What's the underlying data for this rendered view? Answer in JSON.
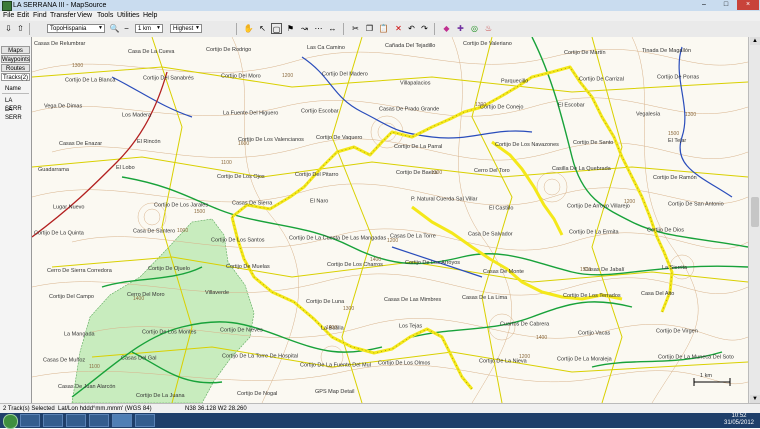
{
  "window": {
    "title": "LA SERRANA III - MapSource",
    "minimize": "–",
    "maximize": "□",
    "close": "×"
  },
  "menu": [
    "File",
    "Edit",
    "Find",
    "Transfer",
    "View",
    "Tools",
    "Utilities",
    "Help"
  ],
  "toolbar": {
    "map_product": "TopoHispania",
    "zoom_level": "1 km",
    "detail": "Highest"
  },
  "sidebar": {
    "tabs": [
      "Maps",
      "Waypoints",
      "Routes",
      "Tracks(2)"
    ],
    "column_header": "Name",
    "items": [
      "LA SERR",
      "LA SERR"
    ]
  },
  "map": {
    "labels": [
      "Casas De Relumbrar",
      "Casa De La Cueva",
      "Cortijo De Rodrigo",
      "Las Ca Camino",
      "Cañada Del Tejadillo",
      "Cortijo De Valeriano",
      "Cortijo De Martín",
      "Tinada De Magallón",
      "Cortijo De La Blanca",
      "Cortijo Del Sanabrés",
      "Cortijo Del Moro",
      "Cortijo Del Madero",
      "Villapalacios",
      "Parquecillo",
      "Cortijo De Carrizal",
      "Cortijo De Porras",
      "Vega De Dimas",
      "Los Madera",
      "La Fuente Del Higuero",
      "Cortijo Escobar",
      "Casas De Prado Grande",
      "Cortijo De Conejo",
      "El Escobar",
      "Vegalesía",
      "Casas De Enazar",
      "El Rincón",
      "Cortijo De Los Valencianos",
      "Cortijo De Vaquero",
      "Cortijo De La Parral",
      "Cortijo De Los Navazones",
      "Cortijo De Santo",
      "El Tejar",
      "Guadarrama",
      "El Lobo",
      "Cortijo De Los Ojos",
      "Cortijo Del Pitarro",
      "Cortijo De Baeza",
      "Cerro Del Toro",
      "Casilla De La Quebrada",
      "Cortijo De Ramón",
      "Lugar Nuevo",
      "Cortijo De Los Jarales",
      "Casas De Sierra",
      "El Naro",
      "P. Natural Cuerda Sal Villar",
      "El Castillo",
      "Cortijo De Arroyo Villarejo",
      "Cortijo De San Antonio",
      "Cortijo De La Quinta",
      "Casa De Santero",
      "Cortijo De Los Santos",
      "Cortijo De La Cuesta De Las Mangadas",
      "Casas De La Torre",
      "Casa De Salvador",
      "Cortijo De La Ermita",
      "Cortijo De Dios",
      "Cerro De Sierra Corredora",
      "Cortijo De Ojuelo",
      "Cortijo De Muelas",
      "Cortijo De Los Charros",
      "Cortijo De Los Arroyos",
      "Casas De Monte",
      "Casas De Jabalí",
      "La Sierrita",
      "Cortijo Del Campo",
      "Cerro Del Moro",
      "Villaverde",
      "Cortijo De Luna",
      "Casas De Las Mimbres",
      "Casas De La Lima",
      "Cortijo De Los Terrados",
      "Casa Del Alto",
      "La Mangada",
      "Cortijo De Los Montes",
      "Cortijo De Nieves",
      "La Batilla",
      "Los Tejas",
      "Cuartos De Cabrera",
      "Cortijo Vacas",
      "Cortijo De Virgen",
      "Casas De Muñoz",
      "Casas Del Gal",
      "Cortijo De La Torre De Hospital",
      "Cortijo De La Fuente Del Mul",
      "Cortijo De Los Olmos",
      "Cortijo De La Nieva",
      "Cortijo De La Moraleja",
      "Cortijo De La Muneca Del Soto",
      "Casas De Juan Alarcón",
      "Cortijo De La Juana",
      "Cortijo De Nogal",
      "GPS Map Detail"
    ],
    "elevations": [
      "1300",
      "1100",
      "1400",
      "1200",
      "1500",
      "1000",
      "1400",
      "1300",
      "1200",
      "1400",
      "1200",
      "1300",
      "1500",
      "1100",
      "1600",
      "1200",
      "1400",
      "1300",
      "1500",
      "1300"
    ],
    "scale_label": "1 km",
    "colors": {
      "track": "#f4e81a",
      "road": "#d9d000",
      "stream": "#18a23a",
      "river": "#2a4dbb",
      "highway": "#b32020",
      "park": "#c8ecbe",
      "contour": "#d8b28a"
    }
  },
  "status": {
    "selected": "2 Track(s) Selected",
    "coord_format": "Lat/Lon hddd°mm.mmm' (WGS 84)",
    "coords": "N38 36.128 W2 28.260"
  },
  "taskbar": {
    "time": "10:52",
    "date": "31/05/2012"
  }
}
